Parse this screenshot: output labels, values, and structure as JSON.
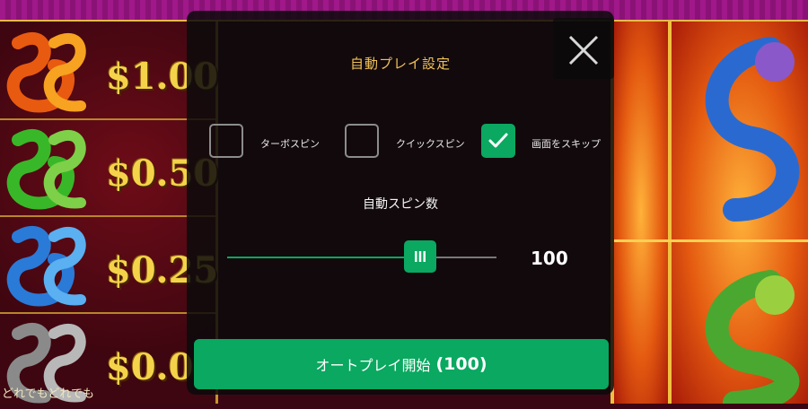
{
  "paytable": {
    "values": [
      "$1.00",
      "$0.50",
      "$0.25",
      "$0.0"
    ],
    "dragon_colors": [
      "#e85a10",
      "#38b828",
      "#2a7ad8",
      "#8a8a8a"
    ],
    "bottom_caption": "どれでもどれでも"
  },
  "modal": {
    "title": "自動プレイ設定",
    "close_icon": "close-icon",
    "options": [
      {
        "label": "ターボスピン",
        "checked": false
      },
      {
        "label": "クイックスピン",
        "checked": false
      },
      {
        "label": "画面をスキップ",
        "checked": true
      }
    ],
    "spin_count_label": "自動スピン数",
    "slider": {
      "value": "100",
      "fraction": 0.72
    },
    "start_button": {
      "label": "オートプレイ開始",
      "count": "(100)"
    }
  },
  "colors": {
    "accent_green": "#0aa860",
    "title_gold": "#f0c25a",
    "banner_magenta": "#a0188a"
  }
}
